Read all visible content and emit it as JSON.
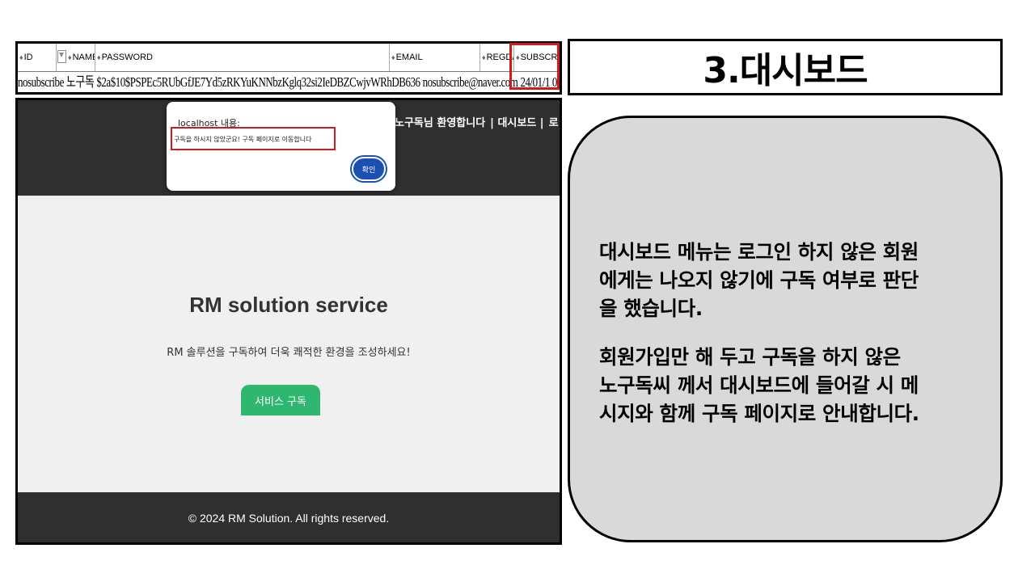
{
  "db_table": {
    "columns": [
      {
        "sort": "♦",
        "label": "ID"
      },
      {
        "sort": "♦",
        "label": "NAME"
      },
      {
        "sort": "♦",
        "label": "PASSWORD"
      },
      {
        "sort": "♦",
        "label": "EMAIL"
      },
      {
        "sort": "♦",
        "label": "REGDATE"
      },
      {
        "sort": "♦",
        "label": "SUBSCRIBED"
      }
    ],
    "row": {
      "id": "nosubscribe",
      "name": "노구독",
      "password": "$2a$10$PSPEc5RUbGfJE7Yd5zRKYuKNNbzKglq32si2IeDBZCwjvWRhDB636",
      "email": "nosubscribe@naver.com",
      "regdate": "24/01/1",
      "subscribed": "0"
    }
  },
  "slide_title": "3.대시보드",
  "browser": {
    "header_nav": [
      "노구독님 환영합니다",
      "| 대시보드 |",
      "로"
    ],
    "alert": {
      "title": "localhost 내용:",
      "message": "구독을 하시지 않았군요! 구독 페이지로 이동합니다",
      "ok_label": "확인"
    },
    "hero_title": "RM solution service",
    "hero_subtitle": "RM 솔루션을 구독하여 더욱 쾌적한 환경을 조성하세요!",
    "subscribe_button": "서비스 구독",
    "footer": "© 2024 RM Solution. All rights reserved."
  },
  "description": {
    "paragraph1": "대시보드 메뉴는 로그인 하지 않은 회원\n에게는 나오지 않기에 구독 여부로 판단\n을 했습니다.",
    "paragraph2": "회원가입만 해 두고 구독을 하지 않은\n노구독씨 께서  대시보드에 들어갈 시 메\n시지와 함께 구독 페이지로 안내합니다."
  },
  "colors": {
    "highlight": "#d21a1a",
    "site_dark": "#2f2f2f",
    "subscribe_green": "#2fb66f",
    "card_gray": "#d9d9d9",
    "alert_blue": "#1a4fb3"
  }
}
